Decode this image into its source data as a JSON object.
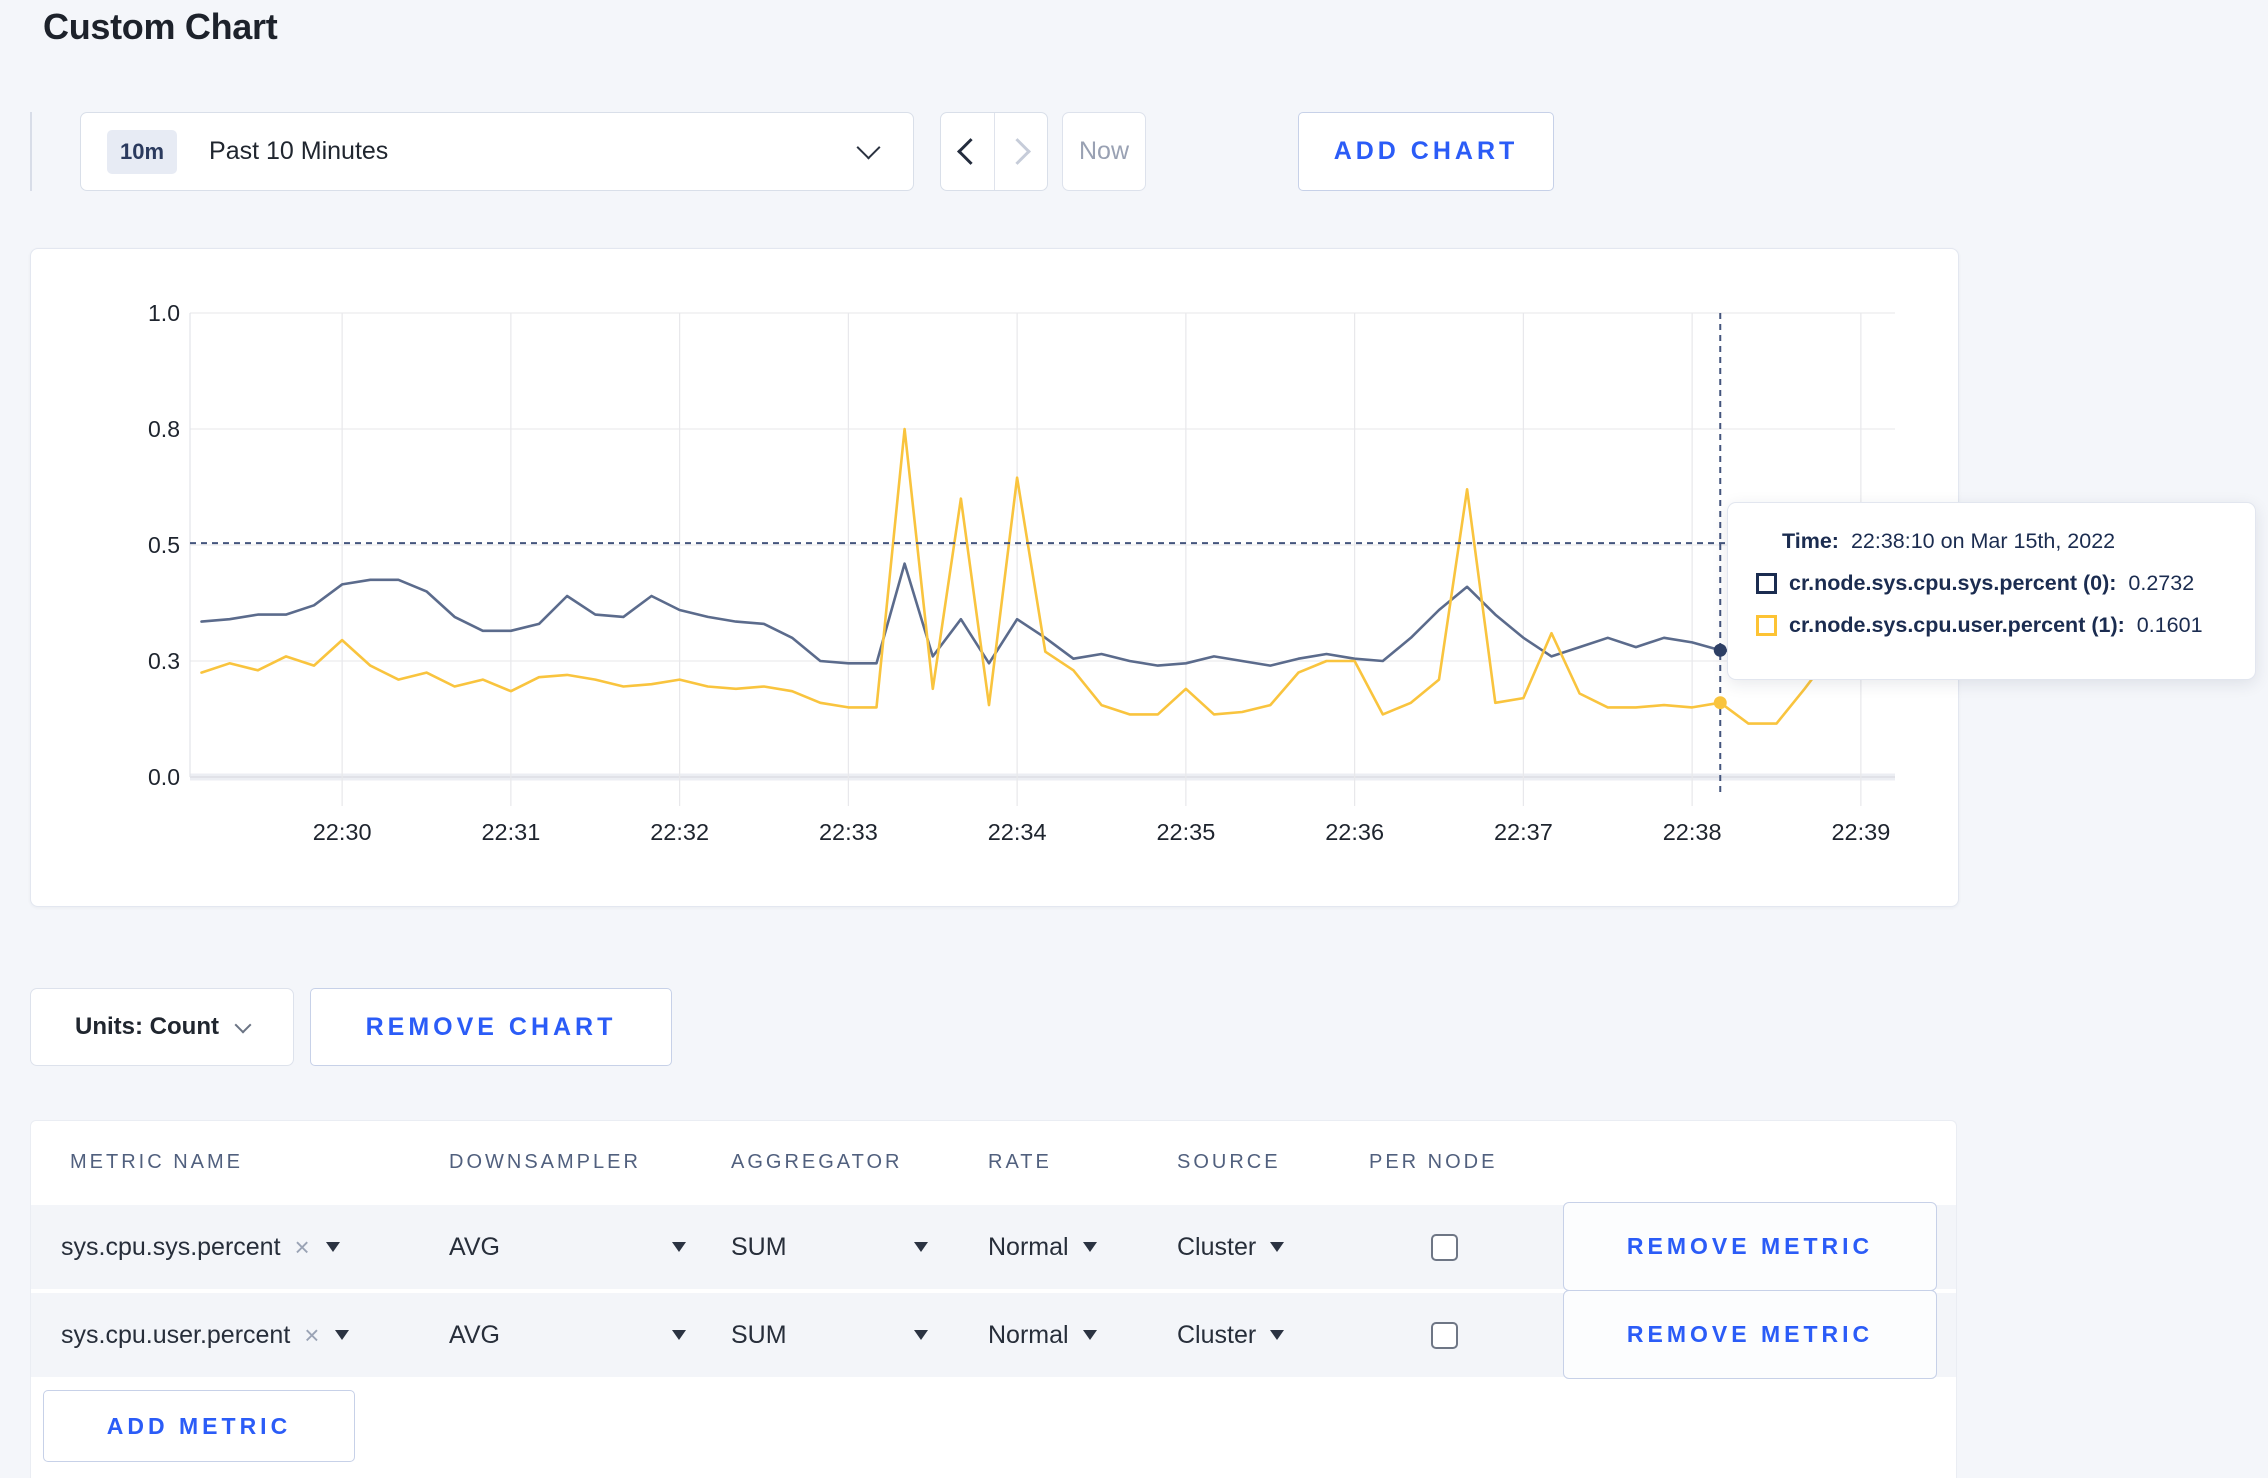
{
  "page": {
    "title": "Custom Chart"
  },
  "toolbar": {
    "time_badge": "10m",
    "time_label": "Past 10 Minutes",
    "prev_label": "previous time window",
    "next_label": "next time window",
    "now_label": "Now",
    "add_chart_label": "ADD CHART"
  },
  "icons": {
    "time_dropdown": "chevron-down-icon",
    "prev": "chevron-left-icon",
    "next": "chevron-right-icon",
    "units_dropdown": "chevron-down-icon",
    "metric_remove_token": "x-icon",
    "select_caret": "triangle-down-icon"
  },
  "chart_data": {
    "type": "line",
    "title": "",
    "xlabel": "",
    "ylabel": "",
    "ylim": [
      0,
      1
    ],
    "grid": true,
    "legend_position": "tooltip",
    "y_ticks": [
      {
        "value": 0,
        "label": "0.0"
      },
      {
        "value": 0.25,
        "label": "0.3"
      },
      {
        "value": 0.5,
        "label": "0.5"
      },
      {
        "value": 0.75,
        "label": "0.8"
      },
      {
        "value": 1,
        "label": "1.0"
      }
    ],
    "x_ticks": [
      "22:30",
      "22:31",
      "22:32",
      "22:33",
      "22:34",
      "22:35",
      "22:36",
      "22:37",
      "22:38",
      "22:39"
    ],
    "x": [
      "22:29:10",
      "22:29:20",
      "22:29:30",
      "22:29:40",
      "22:29:50",
      "22:30:00",
      "22:30:10",
      "22:30:20",
      "22:30:30",
      "22:30:40",
      "22:30:50",
      "22:31:00",
      "22:31:10",
      "22:31:20",
      "22:31:30",
      "22:31:40",
      "22:31:50",
      "22:32:00",
      "22:32:10",
      "22:32:20",
      "22:32:30",
      "22:32:40",
      "22:32:50",
      "22:33:00",
      "22:33:10",
      "22:33:20",
      "22:33:30",
      "22:33:40",
      "22:33:50",
      "22:34:00",
      "22:34:10",
      "22:34:20",
      "22:34:30",
      "22:34:40",
      "22:34:50",
      "22:35:00",
      "22:35:10",
      "22:35:20",
      "22:35:30",
      "22:35:40",
      "22:35:50",
      "22:36:00",
      "22:36:10",
      "22:36:20",
      "22:36:30",
      "22:36:40",
      "22:36:50",
      "22:37:00",
      "22:37:10",
      "22:37:20",
      "22:37:30",
      "22:37:40",
      "22:37:50",
      "22:38:00",
      "22:38:10",
      "22:38:20",
      "22:38:30",
      "22:38:40",
      "22:38:50",
      "22:39:00",
      "22:39:10"
    ],
    "series": [
      {
        "name": "cr.node.sys.cpu.sys.percent",
        "color": "#5b6b8c",
        "dot_color": "#2e4066",
        "values": [
          0.335,
          0.34,
          0.35,
          0.35,
          0.37,
          0.415,
          0.425,
          0.425,
          0.4,
          0.345,
          0.315,
          0.315,
          0.33,
          0.39,
          0.35,
          0.345,
          0.39,
          0.36,
          0.345,
          0.335,
          0.33,
          0.3,
          0.25,
          0.245,
          0.245,
          0.46,
          0.26,
          0.34,
          0.245,
          0.34,
          0.3,
          0.255,
          0.265,
          0.25,
          0.24,
          0.245,
          0.26,
          0.25,
          0.24,
          0.255,
          0.265,
          0.255,
          0.25,
          0.3,
          0.36,
          0.41,
          0.35,
          0.3,
          0.26,
          0.28,
          0.3,
          0.28,
          0.3,
          0.29,
          0.2732,
          0.27,
          0.26,
          0.27,
          0.29,
          0.3,
          0.315
        ]
      },
      {
        "name": "cr.node.sys.cpu.user.percent",
        "color": "#f9c43e",
        "dot_color": "#f5b center",
        "values": [
          0.225,
          0.245,
          0.23,
          0.26,
          0.24,
          0.295,
          0.24,
          0.21,
          0.225,
          0.195,
          0.21,
          0.185,
          0.215,
          0.22,
          0.21,
          0.195,
          0.2,
          0.21,
          0.195,
          0.19,
          0.195,
          0.185,
          0.16,
          0.15,
          0.15,
          0.75,
          0.19,
          0.6,
          0.155,
          0.645,
          0.27,
          0.23,
          0.155,
          0.135,
          0.135,
          0.19,
          0.135,
          0.14,
          0.155,
          0.225,
          0.25,
          0.25,
          0.135,
          0.16,
          0.21,
          0.62,
          0.16,
          0.17,
          0.31,
          0.18,
          0.15,
          0.15,
          0.155,
          0.15,
          0.1601,
          0.115,
          0.115,
          0.19,
          0.27,
          0.235,
          0.225
        ]
      }
    ]
  },
  "tooltip": {
    "time_label": "Time:",
    "time_value": "22:38:10 on Mar 15th, 2022",
    "rows": [
      {
        "label": "cr.node.sys.cpu.sys.percent (0):",
        "value": "0.2732",
        "color": "#1b2c50"
      },
      {
        "label": "cr.node.sys.cpu.user.percent (1):",
        "value": "0.1601",
        "color": "#fdc334"
      }
    ],
    "crosshair": {
      "time": "22:38:10",
      "y_value": 0.504
    }
  },
  "chart_controls": {
    "units_label": "Units: Count",
    "remove_chart_label": "REMOVE CHART"
  },
  "metrics_table": {
    "headers": [
      "METRIC NAME",
      "DOWNSAMPLER",
      "AGGREGATOR",
      "RATE",
      "SOURCE",
      "PER NODE"
    ],
    "rows": [
      {
        "metric": "sys.cpu.sys.percent",
        "remove_token": "×",
        "downsampler": "AVG",
        "aggregator": "SUM",
        "rate": "Normal",
        "source": "Cluster",
        "per_node_checked": false,
        "remove_label": "REMOVE METRIC"
      },
      {
        "metric": "sys.cpu.user.percent",
        "remove_token": "×",
        "downsampler": "AVG",
        "aggregator": "SUM",
        "rate": "Normal",
        "source": "Cluster",
        "per_node_checked": false,
        "remove_label": "REMOVE METRIC"
      }
    ],
    "add_metric_label": "ADD METRIC"
  }
}
